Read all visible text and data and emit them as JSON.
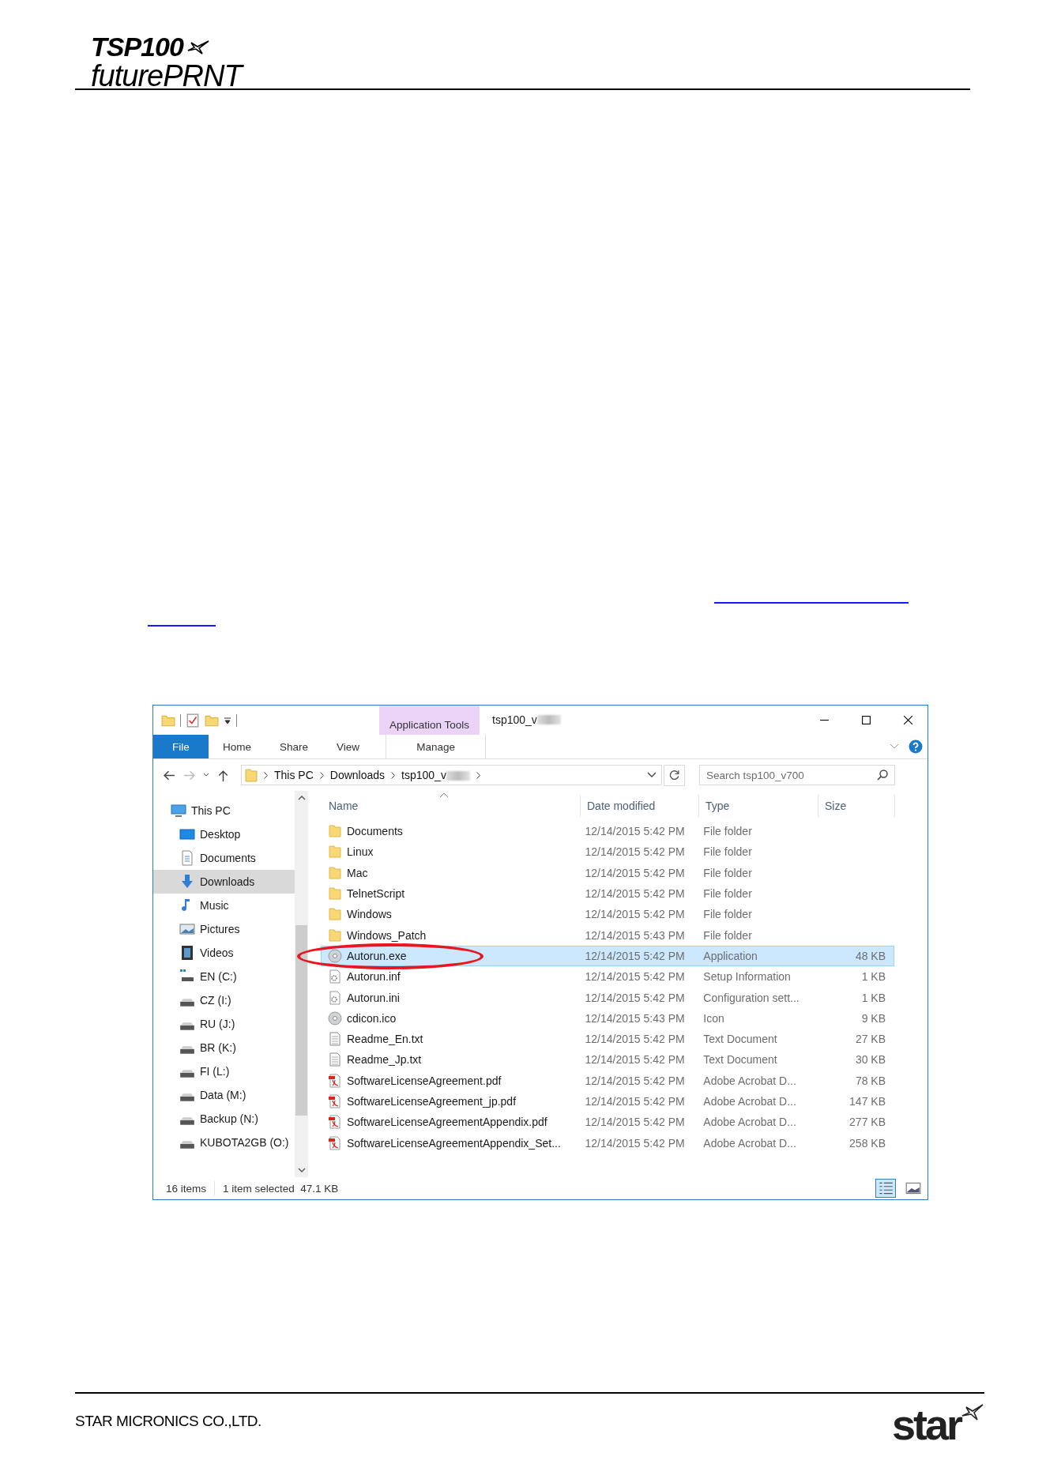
{
  "header": {
    "logo_line1": "TSP100",
    "logo_line2": "futurePRNT"
  },
  "explorer": {
    "title": "tsp100_v",
    "context_tab": "Application Tools",
    "ribbon_tabs": [
      {
        "label": "File",
        "kind": "file",
        "selected": false
      },
      {
        "label": "Home",
        "kind": "tab",
        "selected": false
      },
      {
        "label": "Share",
        "kind": "tab",
        "selected": false
      },
      {
        "label": "View",
        "kind": "tab",
        "selected": false
      },
      {
        "label": "Manage",
        "kind": "context",
        "selected": false
      }
    ],
    "address": [
      "This PC",
      "Downloads",
      "tsp100_v"
    ],
    "search": {
      "placeholder": "Search tsp100_v700"
    },
    "nav": [
      {
        "label": "This PC",
        "kind": "pc",
        "selected": false,
        "children": [
          {
            "label": "Desktop",
            "kind": "desktop",
            "selected": false
          },
          {
            "label": "Documents",
            "kind": "documents",
            "selected": false
          },
          {
            "label": "Downloads",
            "kind": "downloads",
            "selected": true
          },
          {
            "label": "Music",
            "kind": "music",
            "selected": false
          },
          {
            "label": "Pictures",
            "kind": "pictures",
            "selected": false
          },
          {
            "label": "Videos",
            "kind": "videos",
            "selected": false
          },
          {
            "label": "EN (C:)",
            "kind": "system-drive",
            "selected": false
          },
          {
            "label": "CZ (I:)",
            "kind": "drive",
            "selected": false
          },
          {
            "label": "RU (J:)",
            "kind": "drive",
            "selected": false
          },
          {
            "label": "BR (K:)",
            "kind": "drive",
            "selected": false
          },
          {
            "label": "FI (L:)",
            "kind": "drive",
            "selected": false
          },
          {
            "label": "Data (M:)",
            "kind": "drive",
            "selected": false
          },
          {
            "label": "Backup (N:)",
            "kind": "drive",
            "selected": false
          },
          {
            "label": "KUBOTA2GB (O:)",
            "kind": "drive",
            "selected": false
          }
        ]
      }
    ],
    "columns": [
      "Name",
      "Date modified",
      "Type",
      "Size"
    ],
    "rows": [
      {
        "name": "Documents",
        "date": "12/14/2015 5:42 PM",
        "type": "File folder",
        "kind": "folder",
        "selected": false
      },
      {
        "name": "Linux",
        "date": "12/14/2015 5:42 PM",
        "type": "File folder",
        "kind": "folder",
        "selected": false
      },
      {
        "name": "Mac",
        "date": "12/14/2015 5:42 PM",
        "type": "File folder",
        "kind": "folder",
        "selected": false
      },
      {
        "name": "TelnetScript",
        "date": "12/14/2015 5:42 PM",
        "type": "File folder",
        "kind": "folder",
        "selected": false
      },
      {
        "name": "Windows",
        "date": "12/14/2015 5:42 PM",
        "type": "File folder",
        "kind": "folder",
        "selected": false
      },
      {
        "name": "Windows_Patch",
        "date": "12/14/2015 5:43 PM",
        "type": "File folder",
        "kind": "folder",
        "selected": false
      },
      {
        "name": "Autorun.exe",
        "date": "12/14/2015 5:42 PM",
        "type": "Application",
        "size": "48 KB",
        "kind": "disc",
        "selected": true
      },
      {
        "name": "Autorun.inf",
        "date": "12/14/2015 5:42 PM",
        "type": "Setup Information",
        "size": "1 KB",
        "kind": "settings",
        "selected": false
      },
      {
        "name": "Autorun.ini",
        "date": "12/14/2015 5:42 PM",
        "type": "Configuration sett...",
        "size": "1 KB",
        "kind": "settings",
        "selected": false
      },
      {
        "name": "cdicon.ico",
        "date": "12/14/2015 5:43 PM",
        "type": "Icon",
        "size": "9 KB",
        "kind": "disc",
        "selected": false
      },
      {
        "name": "Readme_En.txt",
        "date": "12/14/2015 5:42 PM",
        "type": "Text Document",
        "size": "27 KB",
        "kind": "text",
        "selected": false
      },
      {
        "name": "Readme_Jp.txt",
        "date": "12/14/2015 5:42 PM",
        "type": "Text Document",
        "size": "30 KB",
        "kind": "text",
        "selected": false
      },
      {
        "name": "SoftwareLicenseAgreement.pdf",
        "date": "12/14/2015 5:42 PM",
        "type": "Adobe Acrobat D...",
        "size": "78 KB",
        "kind": "pdf",
        "selected": false
      },
      {
        "name": "SoftwareLicenseAgreement_jp.pdf",
        "date": "12/14/2015 5:42 PM",
        "type": "Adobe Acrobat D...",
        "size": "147 KB",
        "kind": "pdf",
        "selected": false
      },
      {
        "name": "SoftwareLicenseAgreementAppendix.pdf",
        "date": "12/14/2015 5:42 PM",
        "type": "Adobe Acrobat D...",
        "size": "277 KB",
        "kind": "pdf",
        "selected": false
      },
      {
        "name": "SoftwareLicenseAgreementAppendix_Set...",
        "date": "12/14/2015 5:42 PM",
        "type": "Adobe Acrobat D...",
        "size": "258 KB",
        "kind": "pdf",
        "selected": false
      }
    ],
    "status": {
      "count": "16 items",
      "selection": "1 item selected  47.1 KB"
    }
  },
  "footer": {
    "company": "STAR MICRONICS CO.,LTD.",
    "logo": "star"
  }
}
